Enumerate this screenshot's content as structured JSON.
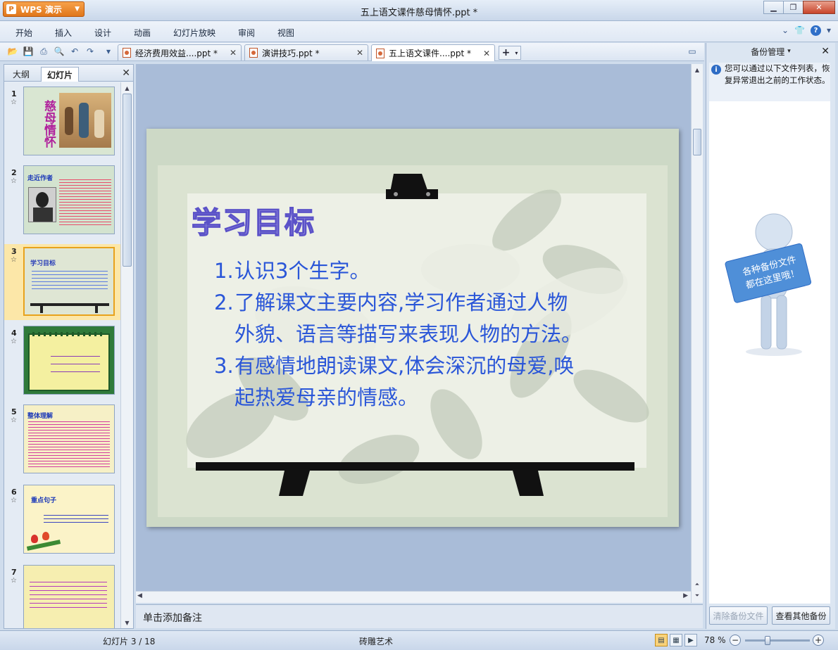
{
  "app": {
    "button_label": "WPS 演示",
    "window_title": "五上语文课件慈母情怀.ppt *"
  },
  "menu": {
    "items": [
      "开始",
      "插入",
      "设计",
      "动画",
      "幻灯片放映",
      "审阅",
      "视图"
    ]
  },
  "tabs": [
    {
      "label": "经济费用效益....ppt *"
    },
    {
      "label": "演讲技巧.ppt *"
    },
    {
      "label": "五上语文课件....ppt *",
      "active": true
    }
  ],
  "left_panel": {
    "tab_outline": "大纲",
    "tab_slides": "幻灯片",
    "thumbnails": [
      {
        "num": "1",
        "title": "慈母情怀"
      },
      {
        "num": "2",
        "title": "走近作者"
      },
      {
        "num": "3",
        "title": "学习目标",
        "selected": true
      },
      {
        "num": "4",
        "title": ""
      },
      {
        "num": "5",
        "title": "整体理解"
      },
      {
        "num": "6",
        "title": "重点句子"
      },
      {
        "num": "7",
        "title": ""
      }
    ]
  },
  "slide": {
    "title": "学习目标",
    "items": [
      {
        "num": "1.",
        "lines": [
          "认识3个生字。"
        ]
      },
      {
        "num": "2.",
        "lines": [
          "了解课文主要内容,学习作者通过人物",
          "外貌、语言等描写来表现人物的方法。"
        ]
      },
      {
        "num": "3.",
        "lines": [
          "有感情地朗读课文,体会深沉的母爱,唤",
          "起热爱母亲的情感。"
        ]
      }
    ]
  },
  "notes": {
    "placeholder": "单击添加备注"
  },
  "right_panel": {
    "title": "备份管理",
    "info": "您可以通过以下文件列表，恢复异常退出之前的工作状态。",
    "sign_line1": "各种备份文件",
    "sign_line2": "都在这里哦！",
    "clear_button": "清除备份文件",
    "view_button": "查看其他备份"
  },
  "status": {
    "slide_counter": "幻灯片 3 / 18",
    "theme": "砖雕艺术",
    "zoom": "78 %"
  },
  "colors": {
    "accent": "#2f6fc8",
    "slide_text": "#2255dd",
    "title_purple": "#6a5acd"
  }
}
